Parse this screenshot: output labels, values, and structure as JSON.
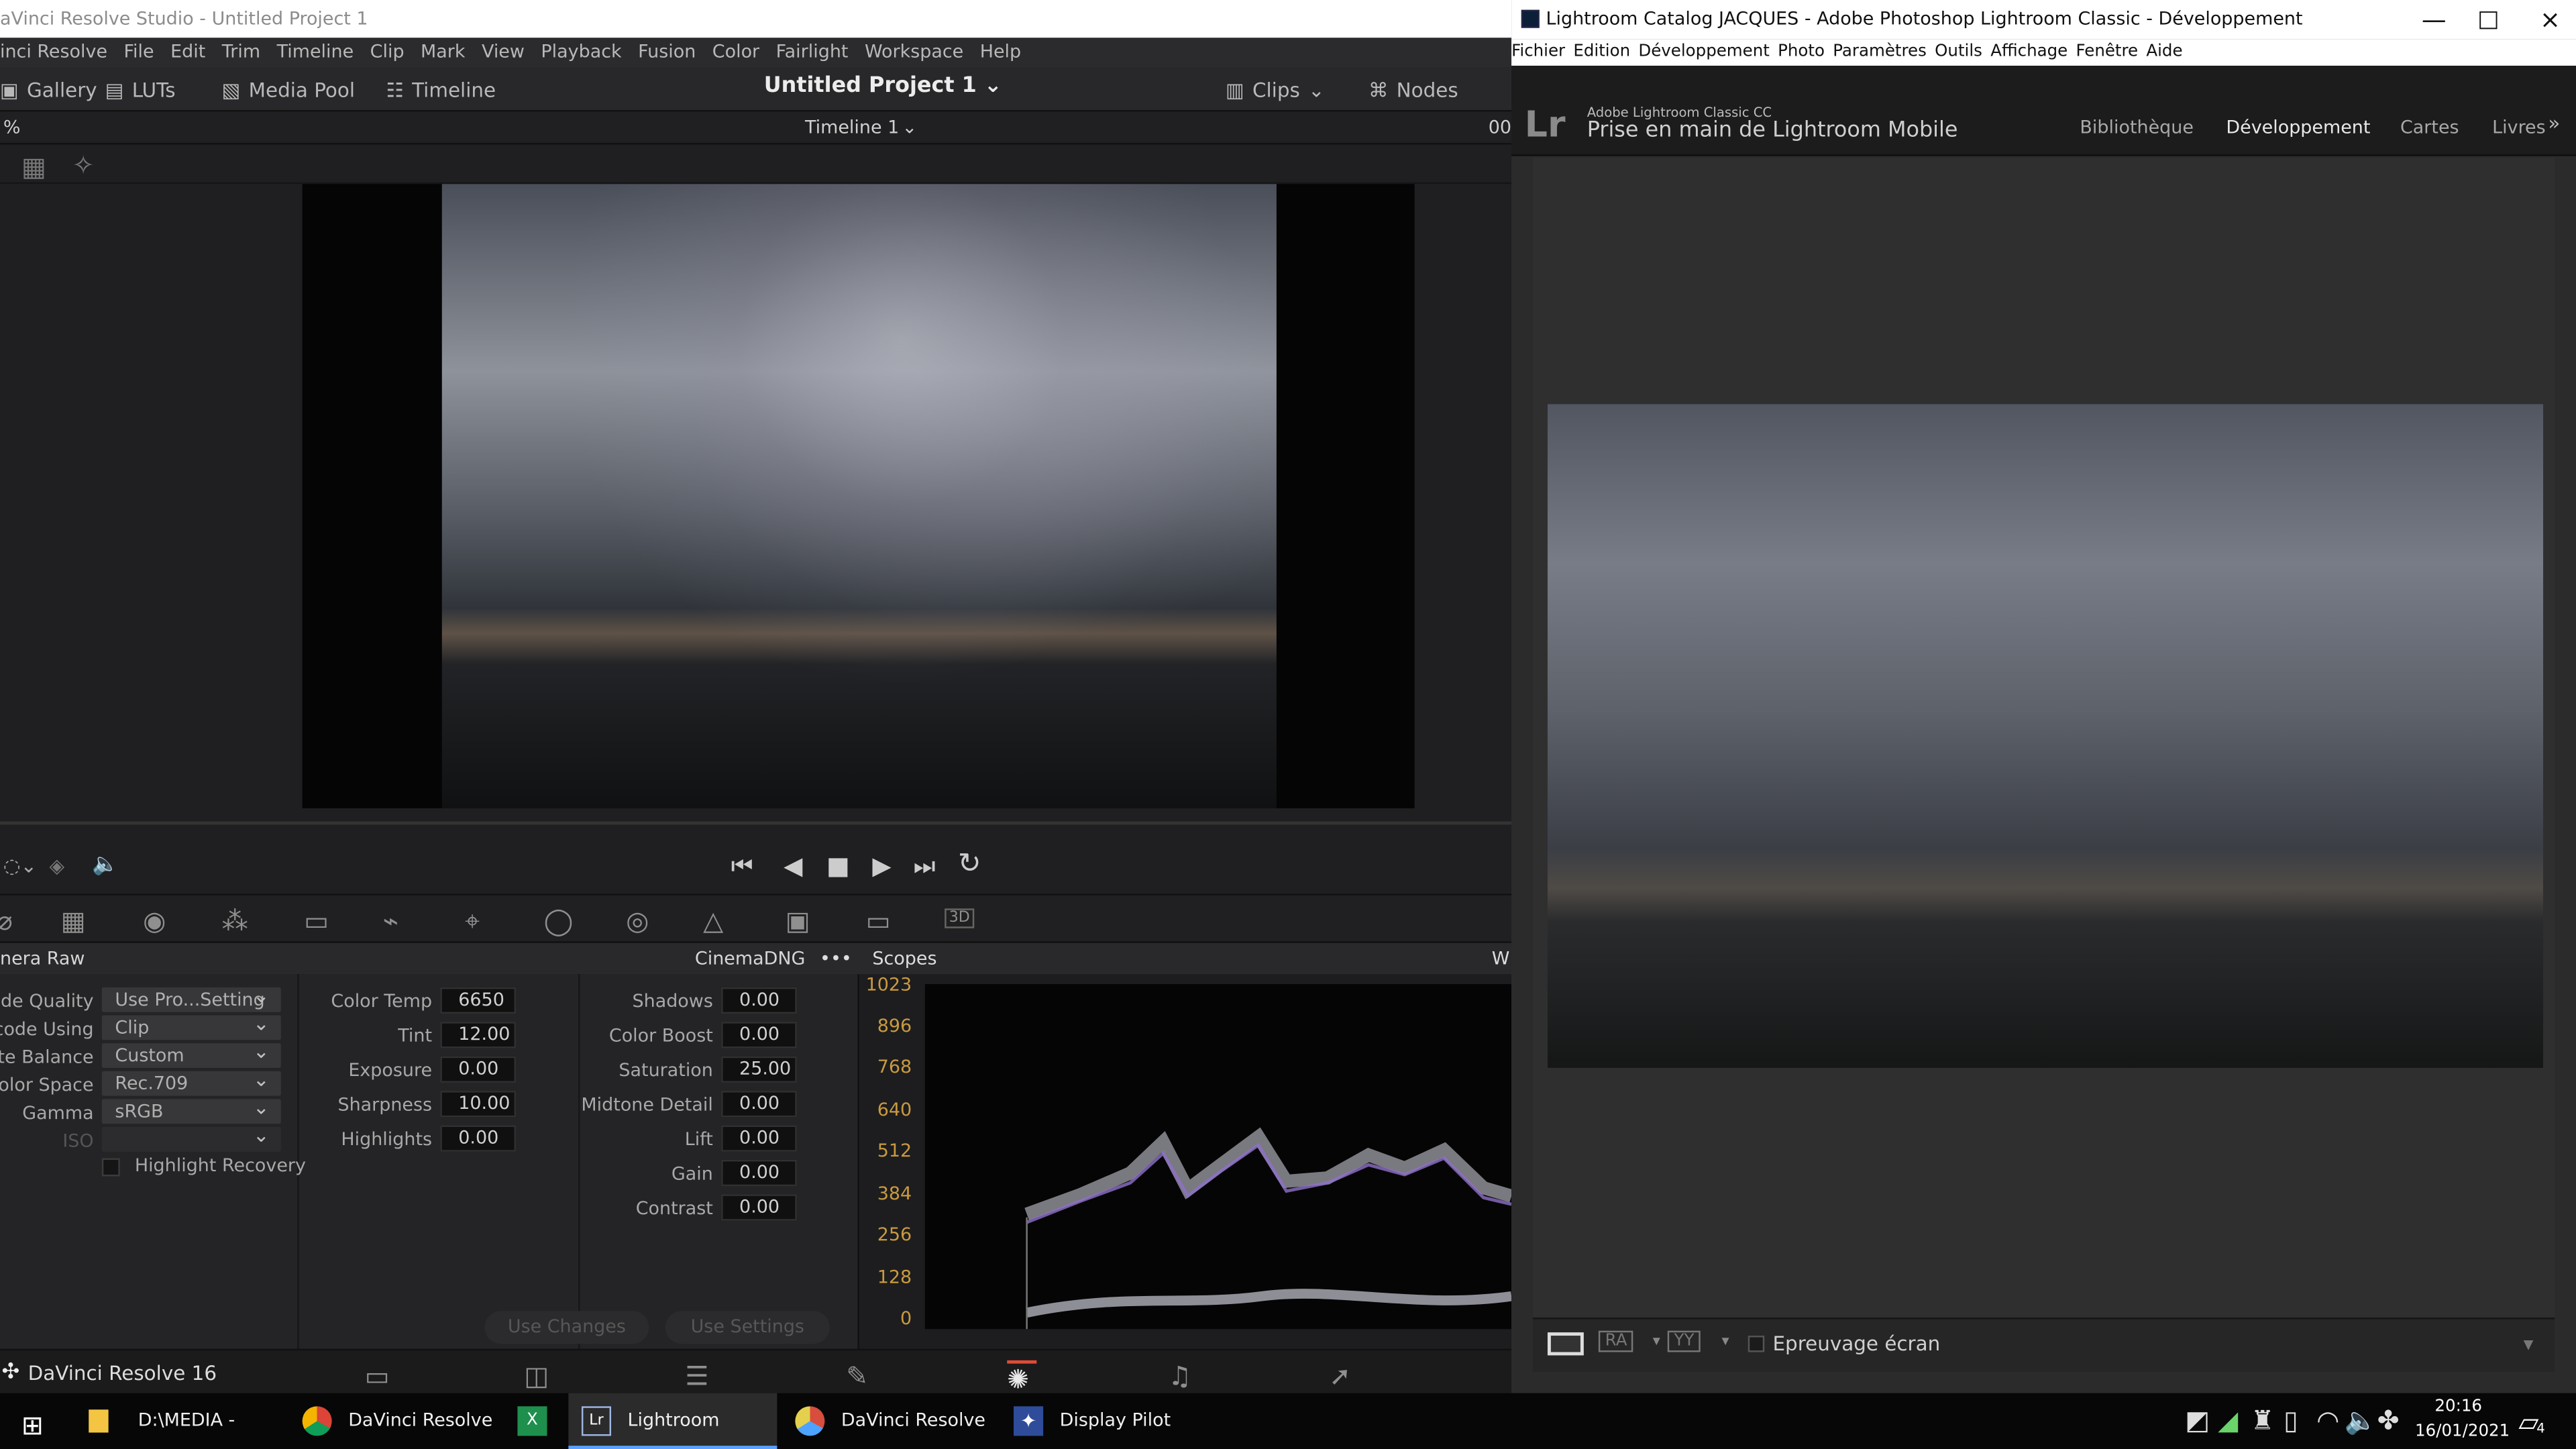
{
  "davinci": {
    "title": "aVinci Resolve Studio - Untitled Project 1",
    "menu": [
      "inci Resolve",
      "File",
      "Edit",
      "Trim",
      "Timeline",
      "Clip",
      "Mark",
      "View",
      "Playback",
      "Fusion",
      "Color",
      "Fairlight",
      "Workspace",
      "Help"
    ],
    "toolbar": {
      "gallery": "Gallery",
      "luts": "LUTs",
      "media_pool": "Media Pool",
      "timeline": "Timeline",
      "project": "Untitled Project 1",
      "clips": "Clips",
      "nodes": "Nodes"
    },
    "subbar": {
      "zoom": "%",
      "timeline": "Timeline 1",
      "timecode": "00:"
    },
    "raw": {
      "title": "nera Raw",
      "format": "CinemaDNG",
      "scopes": "Scopes",
      "right_label": "W",
      "left_labels": [
        "ode Quality",
        "ecode Using",
        "nite Balance",
        "Color Space",
        "Gamma",
        "ISO"
      ],
      "left_values": [
        "Use Pro...Setting",
        "Clip",
        "Custom",
        "Rec.709",
        "sRGB",
        ""
      ],
      "highlight_recovery": "Highlight Recovery",
      "middle_labels": [
        "Color Temp",
        "Tint",
        "Exposure",
        "Sharpness",
        "Highlights"
      ],
      "middle_values": [
        "6650",
        "12.00",
        "0.00",
        "10.00",
        "0.00"
      ],
      "right_labels": [
        "Shadows",
        "Color Boost",
        "Saturation",
        "Midtone Detail",
        "Lift",
        "Gain",
        "Contrast"
      ],
      "right_values": [
        "0.00",
        "0.00",
        "25.00",
        "0.00",
        "0.00",
        "0.00",
        "0.00"
      ],
      "scope_ticks": [
        "1023",
        "896",
        "768",
        "640",
        "512",
        "384",
        "256",
        "128",
        "0"
      ],
      "use_changes": "Use Changes",
      "use_settings": "Use Settings"
    },
    "footer": "DaVinci Resolve 16"
  },
  "lightroom": {
    "title": "Lightroom Catalog JACQUES - Adobe Photoshop Lightroom Classic - Développement",
    "menu": [
      "Fichier",
      "Edition",
      "Développement",
      "Photo",
      "Paramètres",
      "Outils",
      "Affichage",
      "Fenêtre",
      "Aide"
    ],
    "brand_small": "Adobe Lightroom Classic CC",
    "brand_large": "Prise en main de Lightroom Mobile",
    "logo": "Lr",
    "modules": [
      "Bibliothèque",
      "Développement",
      "Cartes",
      "Livres"
    ],
    "proof": "Epreuvage écran",
    "button_ra": "RA",
    "button_yy": "YY"
  },
  "taskbar": {
    "items": [
      "D:\\MEDIA - PRO\\TI...",
      "DaVinci Resolve Us...",
      "",
      "Lightroom Catalog ...",
      "DaVinci Resolve Stu...",
      "Display Pilot"
    ],
    "time": "20:16",
    "date": "16/01/2021",
    "notification_count": "4"
  },
  "colors": {
    "accent_blue": "#5aa0ff",
    "scope_orange": "#c99a3f",
    "lightroom_bg": "#2f2f2f",
    "davinci_bg": "#1f1f21"
  },
  "icons": [
    "gallery-icon",
    "lut-icon",
    "media-pool-icon",
    "timeline-icon",
    "clips-icon",
    "nodes-icon",
    "play-icon",
    "stop-icon",
    "window-controls-icons",
    "windows-icon",
    "chrome-icon",
    "excel-icon",
    "resolve-icon"
  ]
}
